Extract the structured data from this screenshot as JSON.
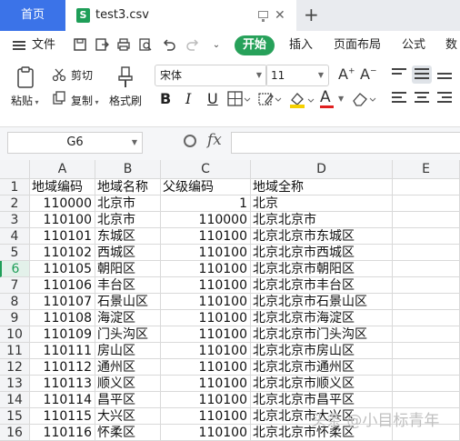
{
  "tabs": {
    "home_label": "首页",
    "file_label": "test3.csv",
    "file_icon": "S"
  },
  "menu": {
    "file_label": "文件",
    "start_label": "开始",
    "insert_label": "插入",
    "page_layout_label": "页面布局",
    "formula_label": "公式",
    "data_label": "数据"
  },
  "toolbar": {
    "paste_label": "粘贴",
    "cut_label": "剪切",
    "copy_label": "复制",
    "format_painter_label": "格式刷",
    "font_name": "宋体",
    "font_size": "11",
    "bold": "B",
    "italic": "I",
    "underline": "U",
    "font_color_letter": "A",
    "font_color": "#e02020",
    "fill_color": "#f5d000"
  },
  "formula_bar": {
    "cell_ref": "G6",
    "fx": "fx",
    "value": ""
  },
  "grid": {
    "columns": [
      "A",
      "B",
      "C",
      "D",
      "E"
    ],
    "active_row": 6,
    "rows": [
      {
        "n": "1",
        "a": "地域编码",
        "b": "地域名称",
        "c": "父级编码",
        "d": "地域全称"
      },
      {
        "n": "2",
        "a": "110000",
        "b": "北京市",
        "c": "1",
        "d": "北京"
      },
      {
        "n": "3",
        "a": "110100",
        "b": "北京市",
        "c": "110000",
        "d": "北京北京市"
      },
      {
        "n": "4",
        "a": "110101",
        "b": "东城区",
        "c": "110100",
        "d": "北京北京市东城区"
      },
      {
        "n": "5",
        "a": "110102",
        "b": "西城区",
        "c": "110100",
        "d": "北京北京市西城区"
      },
      {
        "n": "6",
        "a": "110105",
        "b": "朝阳区",
        "c": "110100",
        "d": "北京北京市朝阳区"
      },
      {
        "n": "7",
        "a": "110106",
        "b": "丰台区",
        "c": "110100",
        "d": "北京北京市丰台区"
      },
      {
        "n": "8",
        "a": "110107",
        "b": "石景山区",
        "c": "110100",
        "d": "北京北京市石景山区"
      },
      {
        "n": "9",
        "a": "110108",
        "b": "海淀区",
        "c": "110100",
        "d": "北京北京市海淀区"
      },
      {
        "n": "10",
        "a": "110109",
        "b": "门头沟区",
        "c": "110100",
        "d": "北京北京市门头沟区"
      },
      {
        "n": "11",
        "a": "110111",
        "b": "房山区",
        "c": "110100",
        "d": "北京北京市房山区"
      },
      {
        "n": "12",
        "a": "110112",
        "b": "通州区",
        "c": "110100",
        "d": "北京北京市通州区"
      },
      {
        "n": "13",
        "a": "110113",
        "b": "顺义区",
        "c": "110100",
        "d": "北京北京市顺义区"
      },
      {
        "n": "14",
        "a": "110114",
        "b": "昌平区",
        "c": "110100",
        "d": "北京北京市昌平区"
      },
      {
        "n": "15",
        "a": "110115",
        "b": "大兴区",
        "c": "110100",
        "d": "北京北京市大兴区"
      },
      {
        "n": "16",
        "a": "110116",
        "b": "怀柔区",
        "c": "110100",
        "d": "北京北京市怀柔区"
      }
    ]
  },
  "watermark": "头条 @小目标青年"
}
